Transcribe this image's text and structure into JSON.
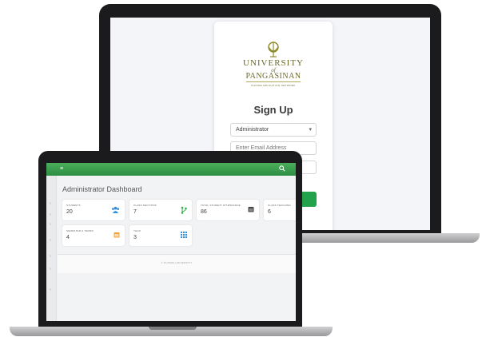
{
  "signup": {
    "logo": {
      "line1": "UNIVERSITY",
      "line2": "of",
      "line3": "PANGASINAN",
      "tagline": "PHINMA EDUCATION NETWORK"
    },
    "title": "Sign Up",
    "role_select": {
      "value": "Administrator"
    },
    "email": {
      "placeholder": "Enter Email Address"
    },
    "accent": "#22a24a"
  },
  "dashboard": {
    "topbar": {
      "menu_icon": "menu-icon",
      "search_icon": "search-icon",
      "color": "#3a9e4f"
    },
    "sidebar": {
      "items": [
        {
          "glyph": "›"
        },
        {
          "glyph": "›"
        },
        {
          "glyph": "›"
        },
        {
          "glyph": "›"
        },
        {
          "glyph": "›"
        },
        {
          "glyph": "›"
        },
        {
          "glyph": "›"
        }
      ]
    },
    "title": "Administrator Dashboard",
    "stats": [
      {
        "label": "STUDENTS",
        "value": "20",
        "icon": "users-icon",
        "icon_color": "#2f8fdf"
      },
      {
        "label": "CLASS SECTIONS",
        "value": "7",
        "icon": "branch-icon",
        "icon_color": "#2fae4a"
      },
      {
        "label": "TOTAL STUDENT ATTENDANCE",
        "value": "86",
        "icon": "calendar-icon",
        "icon_color": "#444444"
      },
      {
        "label": "CLASS TEACHING",
        "value": "6",
        "icon": "chalkboard-icon",
        "icon_color": "#444444"
      },
      {
        "label": "SEMESTER & TERMS",
        "value": "4",
        "icon": "calendar-icon",
        "icon_color": "#f0a23a"
      },
      {
        "label": "YEAR",
        "value": "3",
        "icon": "grid-icon",
        "icon_color": "#2f8fdf"
      }
    ],
    "footer": "© PHINMA UNIVERSITY"
  }
}
